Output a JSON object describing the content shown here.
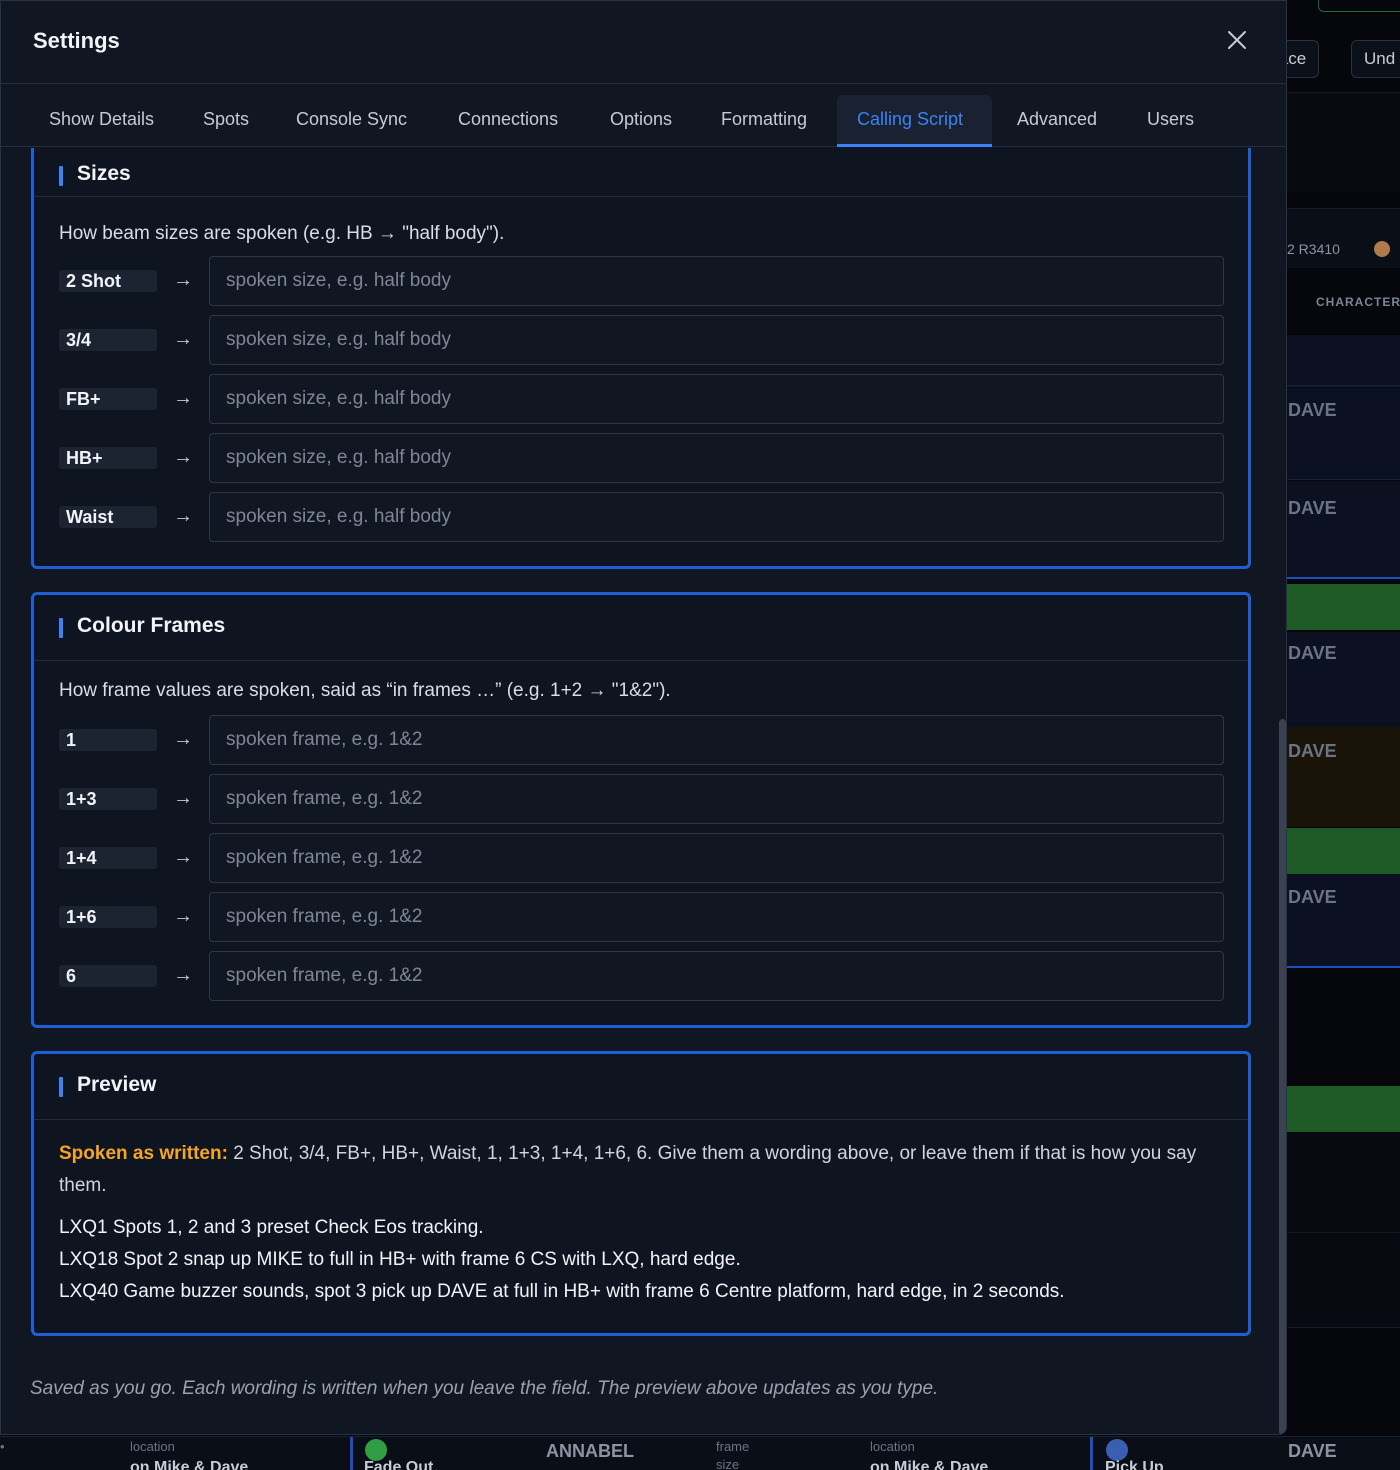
{
  "background": {
    "top_buttons": [
      "lace",
      "Und"
    ],
    "rig_label": "2  R3410",
    "character_label": "CHARACTER",
    "dave_label": "DAVE",
    "bottom": {
      "location_label": "location",
      "location_value": "on Mike & Dave",
      "fade_value": "Fade Out",
      "annabel": "ANNABEL",
      "frame_label": "frame",
      "size_label": "size",
      "location_value_2": "on Mike & Dave",
      "pickup_value": "Pick Up",
      "dave": "DAVE",
      "dot": "•"
    }
  },
  "modal": {
    "title": "Settings",
    "tabs": [
      {
        "label": "Show Details"
      },
      {
        "label": "Spots"
      },
      {
        "label": "Console Sync"
      },
      {
        "label": "Connections"
      },
      {
        "label": "Options"
      },
      {
        "label": "Formatting"
      },
      {
        "label": "Calling Script"
      },
      {
        "label": "Advanced"
      },
      {
        "label": "Users"
      }
    ],
    "active_tab": "Calling Script"
  },
  "sizes": {
    "title": "Sizes",
    "description": "How beam sizes are spoken (e.g. HB → \"half body\").",
    "placeholder": "spoken size, e.g. half body",
    "arrow": "→",
    "rows": [
      {
        "key": "2 Shot",
        "value": ""
      },
      {
        "key": "3/4",
        "value": ""
      },
      {
        "key": "FB+",
        "value": ""
      },
      {
        "key": "HB+",
        "value": ""
      },
      {
        "key": "Waist",
        "value": ""
      }
    ]
  },
  "frames": {
    "title": "Colour Frames",
    "description": "How frame values are spoken, said as “in frames …” (e.g. 1+2 → \"1&2\").",
    "placeholder": "spoken frame, e.g. 1&2",
    "arrow": "→",
    "rows": [
      {
        "key": "1",
        "value": ""
      },
      {
        "key": "1+3",
        "value": ""
      },
      {
        "key": "1+4",
        "value": ""
      },
      {
        "key": "1+6",
        "value": ""
      },
      {
        "key": "6",
        "value": ""
      }
    ]
  },
  "preview": {
    "title": "Preview",
    "warning_label": "Spoken as written:",
    "warning_text": " 2 Shot, 3/4, FB+, HB+, Waist, 1, 1+3, 1+4, 1+6, 6. Give them a wording above, or leave them if that is how you say them.",
    "lines": [
      "LXQ1 Spots 1, 2 and 3 preset Check Eos tracking.",
      "LXQ18 Spot 2 snap up MIKE to full in HB+ with frame 6 CS with LXQ, hard edge.",
      "LXQ40 Game buzzer sounds, spot 3 pick up DAVE at full in HB+ with frame 6 Centre platform, hard edge, in 2 seconds."
    ]
  },
  "footer_note": "Saved as you go. Each wording is written when you leave the field. The preview above updates as you type.",
  "colors": {
    "accent": "#3b82f6",
    "card_border": "#1f5fd6",
    "warning": "#f5a524",
    "panel_bg": "#111722"
  }
}
